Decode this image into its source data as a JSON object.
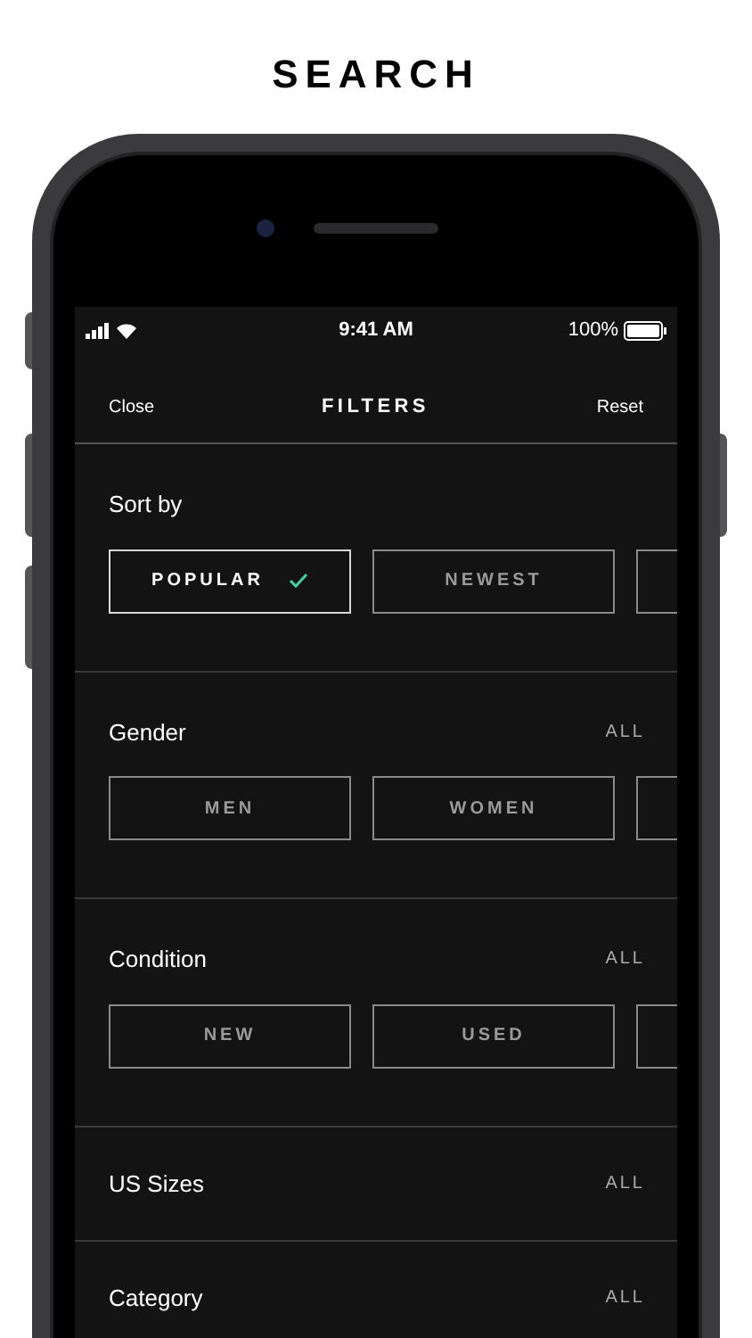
{
  "headline": "SEARCH",
  "status_bar": {
    "time": "9:41 AM",
    "battery": "100%"
  },
  "nav": {
    "left": "Close",
    "title": "FILTERS",
    "right": "Reset"
  },
  "sections": [
    {
      "title": "Sort by",
      "options": [
        {
          "label": "POPULAR",
          "selected": true
        },
        {
          "label": "NEWEST",
          "selected": false
        },
        {
          "selected": false
        }
      ]
    },
    {
      "title": "Gender",
      "value": "ALL",
      "options": [
        {
          "label": "MEN",
          "selected": false
        },
        {
          "label": "WOMEN",
          "selected": false
        },
        {
          "selected": false
        }
      ]
    },
    {
      "title": "Condition",
      "value": "ALL",
      "options": [
        {
          "label": "NEW",
          "selected": false
        },
        {
          "label": "USED",
          "selected": false
        },
        {
          "selected": false
        }
      ]
    },
    {
      "title": "US Sizes",
      "value": "ALL"
    },
    {
      "title": "Category",
      "value": "ALL"
    }
  ]
}
